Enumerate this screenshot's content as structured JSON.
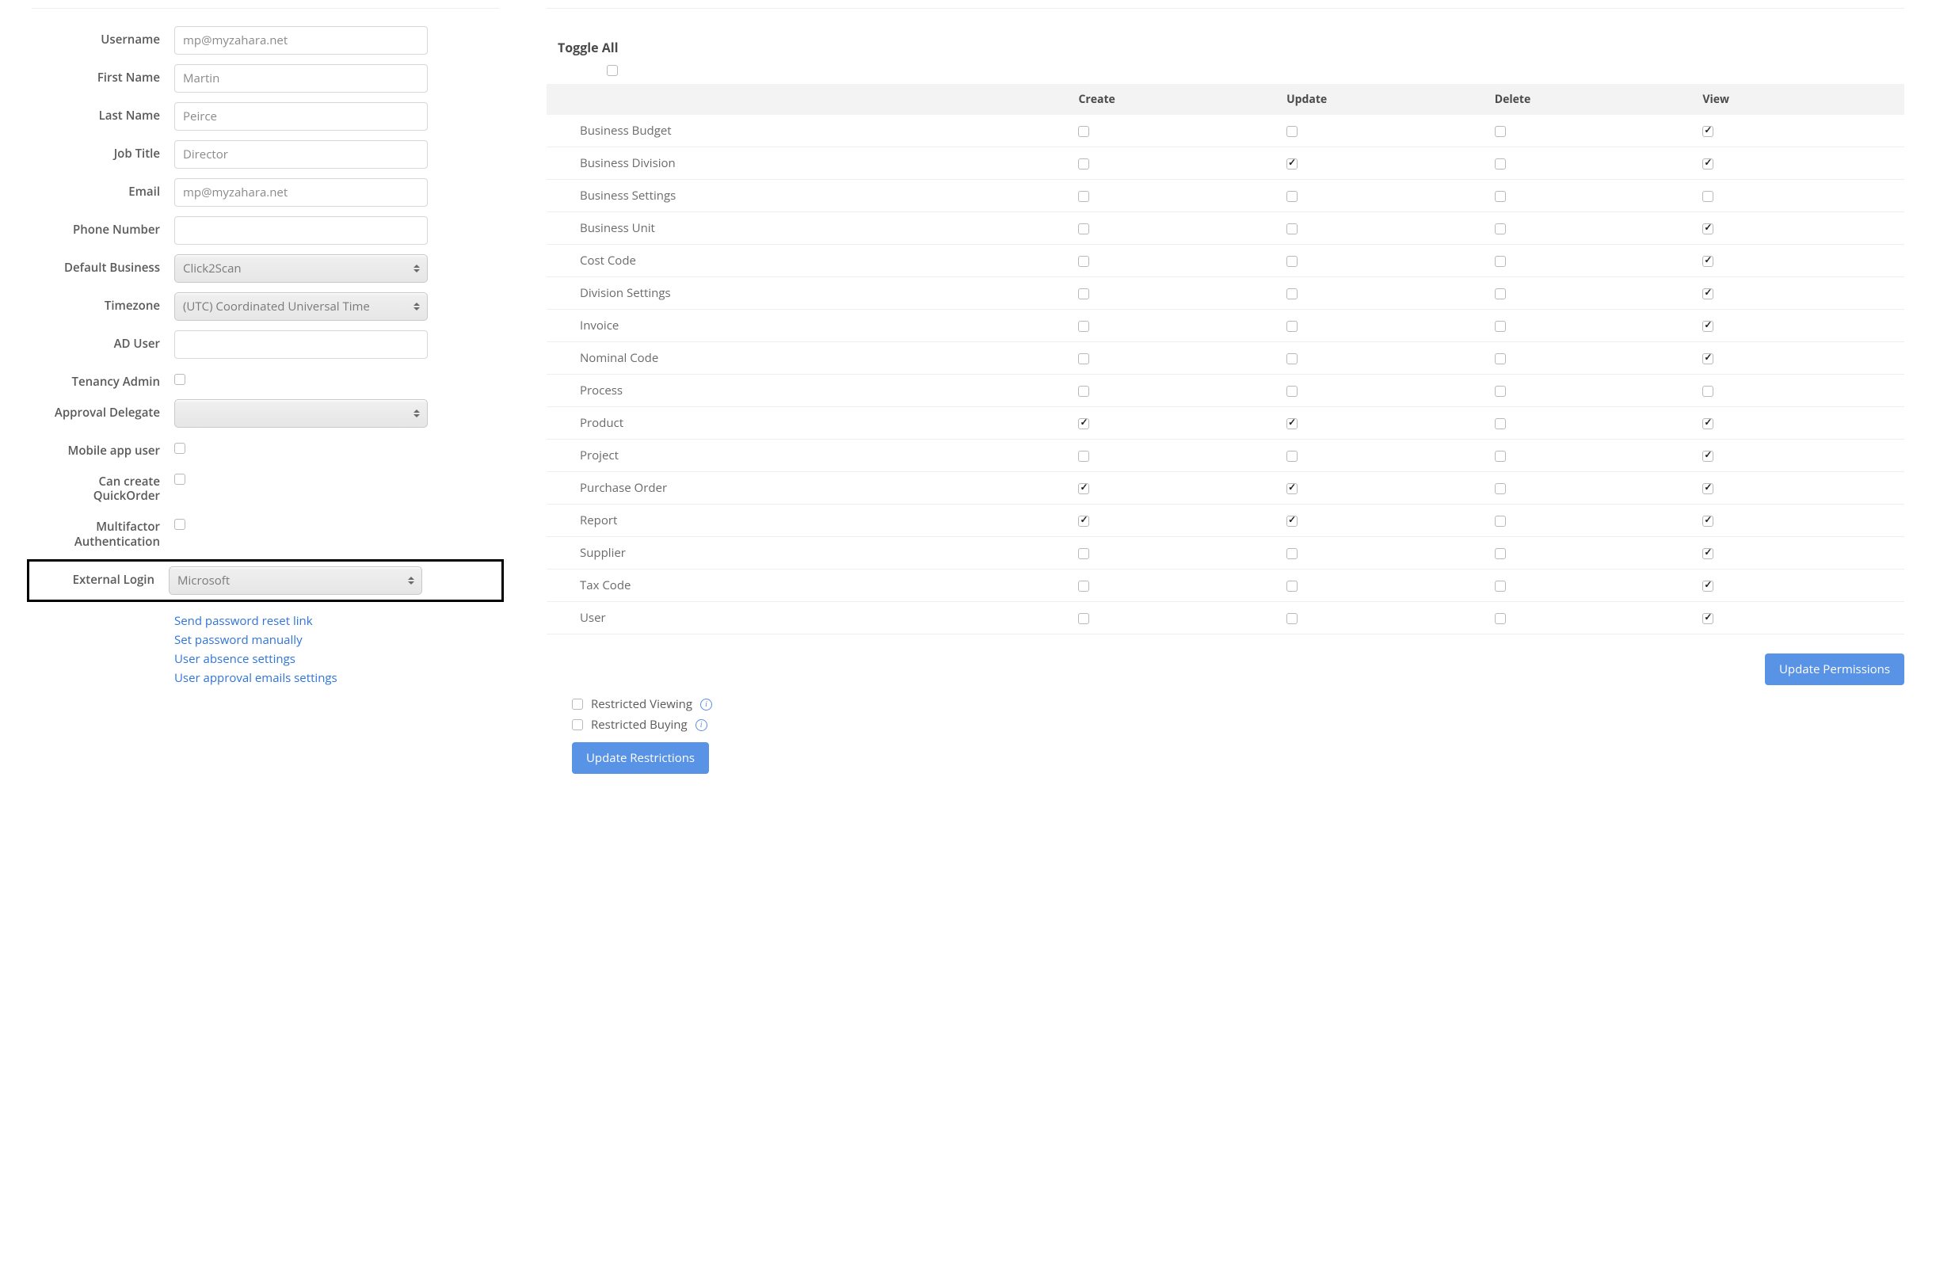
{
  "form": {
    "username": {
      "label": "Username",
      "value": "mp@myzahara.net"
    },
    "firstName": {
      "label": "First Name",
      "value": "Martin"
    },
    "lastName": {
      "label": "Last Name",
      "value": "Peirce"
    },
    "jobTitle": {
      "label": "Job Title",
      "value": "Director"
    },
    "email": {
      "label": "Email",
      "value": "mp@myzahara.net"
    },
    "phone": {
      "label": "Phone Number",
      "value": ""
    },
    "defaultBusiness": {
      "label": "Default Business",
      "value": "Click2Scan"
    },
    "timezone": {
      "label": "Timezone",
      "value": "(UTC) Coordinated Universal Time"
    },
    "adUser": {
      "label": "AD User",
      "value": ""
    },
    "tenancyAdmin": {
      "label": "Tenancy Admin",
      "checked": false
    },
    "approvalDelegate": {
      "label": "Approval Delegate",
      "value": ""
    },
    "mobileAppUser": {
      "label": "Mobile app user",
      "checked": false
    },
    "canCreateQuickOrder": {
      "label": "Can create QuickOrder",
      "checked": false
    },
    "multifactor": {
      "label": "Multifactor Authentication",
      "checked": false
    },
    "externalLogin": {
      "label": "External Login",
      "value": "Microsoft"
    },
    "links": {
      "sendPasswordReset": "Send password reset link",
      "setPasswordManually": "Set password manually",
      "userAbsenceSettings": "User absence settings",
      "userApprovalEmailsSettings": "User approval emails settings"
    }
  },
  "permissions": {
    "toggleAllLabel": "Toggle All",
    "toggleAllChecked": false,
    "columns": [
      "Create",
      "Update",
      "Delete",
      "View"
    ],
    "rows": [
      {
        "name": "Business Budget",
        "create": false,
        "update": false,
        "delete": false,
        "view": true
      },
      {
        "name": "Business Division",
        "create": false,
        "update": true,
        "delete": false,
        "view": true
      },
      {
        "name": "Business Settings",
        "create": false,
        "update": false,
        "delete": false,
        "view": false
      },
      {
        "name": "Business Unit",
        "create": false,
        "update": false,
        "delete": false,
        "view": true
      },
      {
        "name": "Cost Code",
        "create": false,
        "update": false,
        "delete": false,
        "view": true
      },
      {
        "name": "Division Settings",
        "create": false,
        "update": false,
        "delete": false,
        "view": true
      },
      {
        "name": "Invoice",
        "create": false,
        "update": false,
        "delete": false,
        "view": true
      },
      {
        "name": "Nominal Code",
        "create": false,
        "update": false,
        "delete": false,
        "view": true
      },
      {
        "name": "Process",
        "create": false,
        "update": false,
        "delete": false,
        "view": false
      },
      {
        "name": "Product",
        "create": true,
        "update": true,
        "delete": false,
        "view": true
      },
      {
        "name": "Project",
        "create": false,
        "update": false,
        "delete": false,
        "view": true
      },
      {
        "name": "Purchase Order",
        "create": true,
        "update": true,
        "delete": false,
        "view": true
      },
      {
        "name": "Report",
        "create": true,
        "update": true,
        "delete": false,
        "view": true
      },
      {
        "name": "Supplier",
        "create": false,
        "update": false,
        "delete": false,
        "view": true
      },
      {
        "name": "Tax Code",
        "create": false,
        "update": false,
        "delete": false,
        "view": true
      },
      {
        "name": "User",
        "create": false,
        "update": false,
        "delete": false,
        "view": true
      }
    ],
    "updatePermissionsLabel": "Update Permissions"
  },
  "restrictions": {
    "restrictedViewing": {
      "label": "Restricted Viewing",
      "checked": false
    },
    "restrictedBuying": {
      "label": "Restricted Buying",
      "checked": false
    },
    "updateRestrictionsLabel": "Update Restrictions"
  }
}
